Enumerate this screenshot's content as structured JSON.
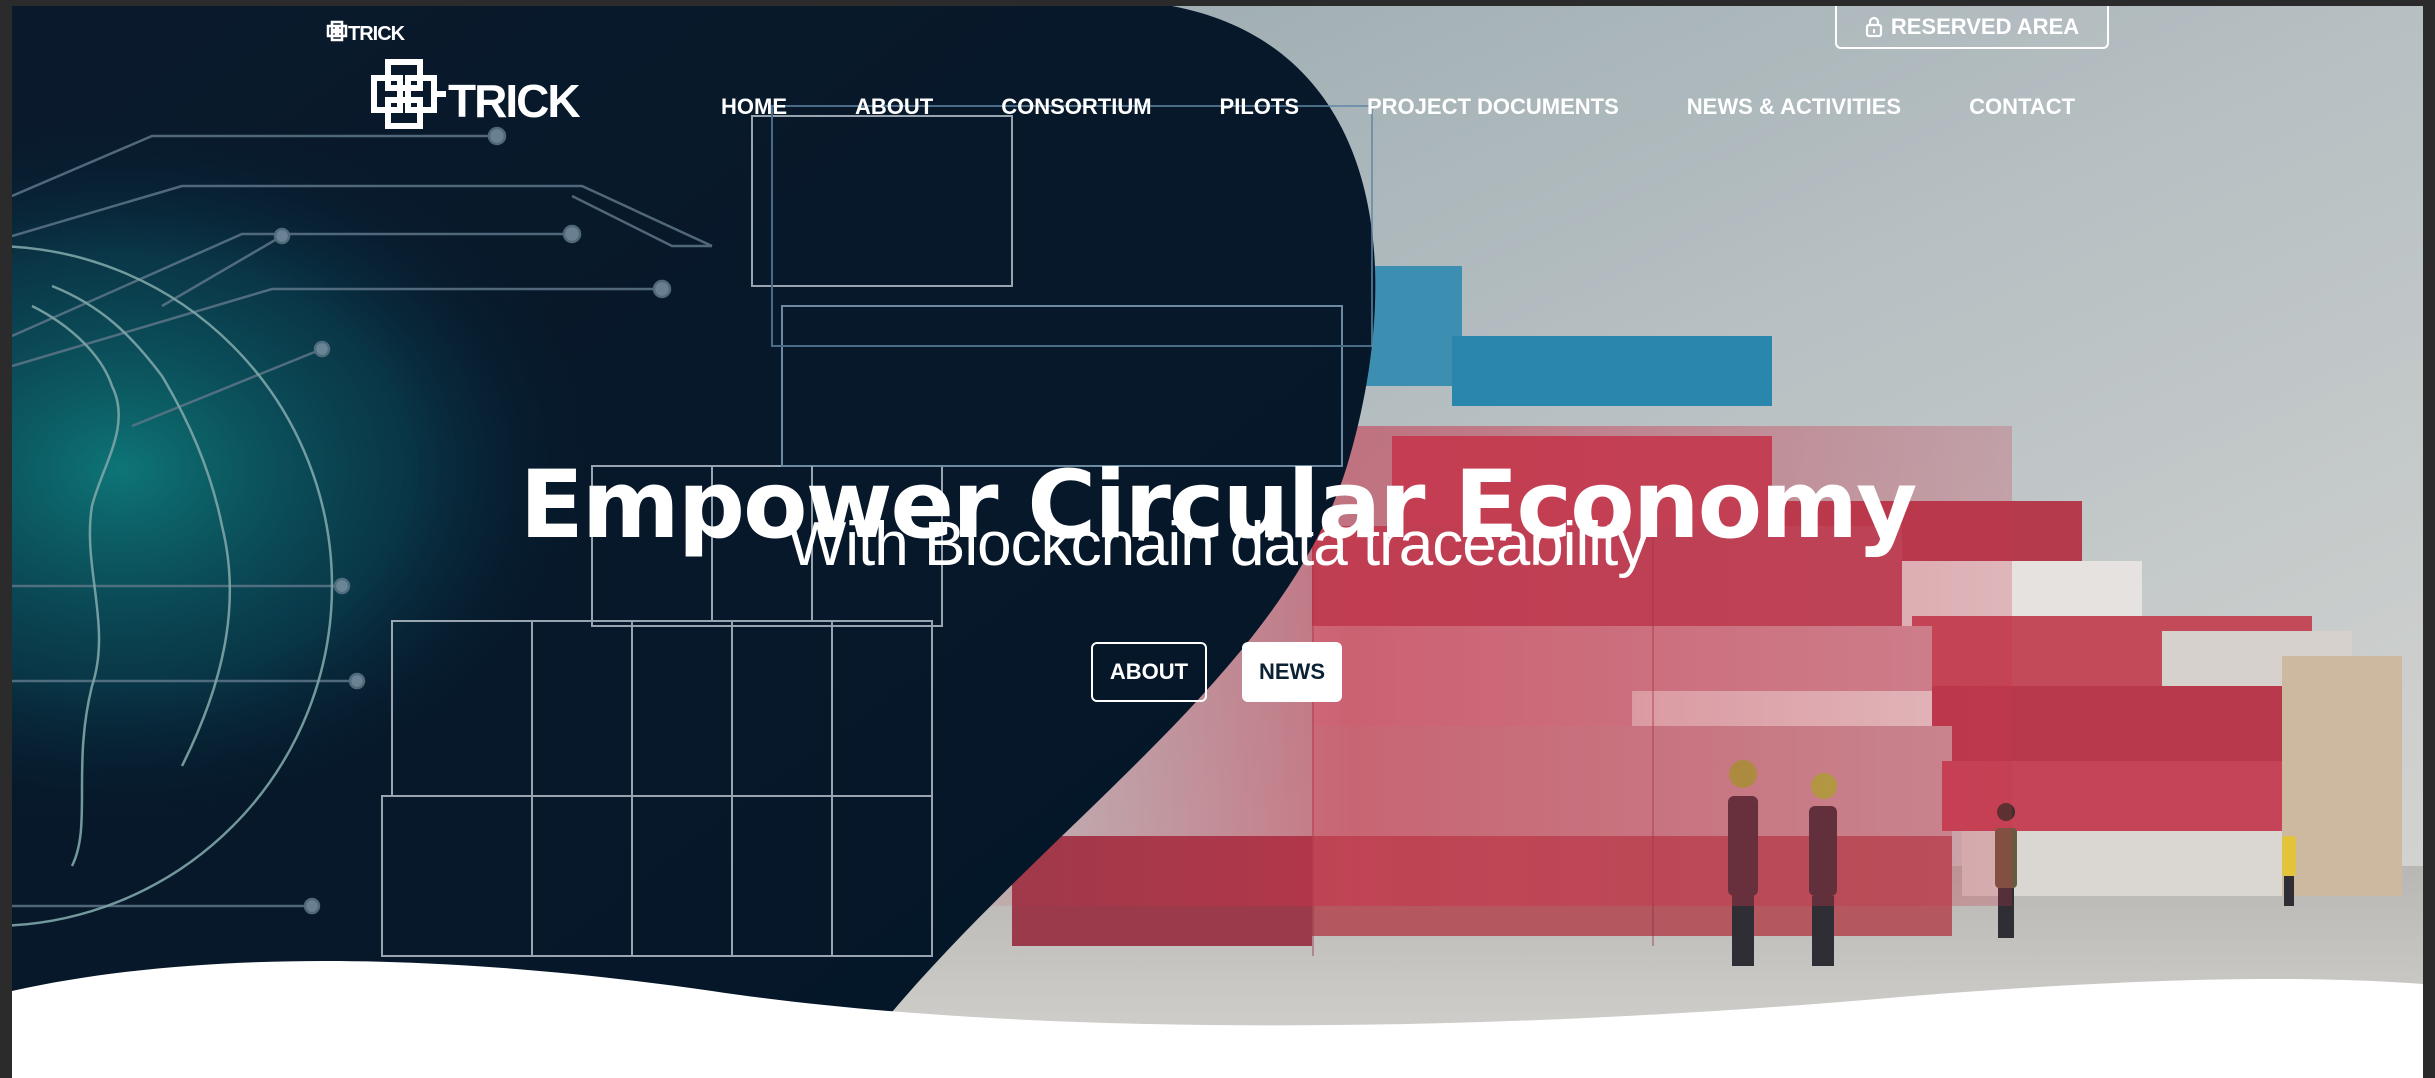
{
  "brand": {
    "logo_small": "TRICK",
    "logo_main": "TRICK"
  },
  "header": {
    "reserved_area": "RESERVED AREA",
    "nav": [
      {
        "label": "HOME"
      },
      {
        "label": "ABOUT"
      },
      {
        "label": "CONSORTIUM"
      },
      {
        "label": "PILOTS"
      },
      {
        "label": "PROJECT DOCUMENTS"
      },
      {
        "label": "NEWS & ACTIVITIES"
      },
      {
        "label": "CONTACT"
      }
    ]
  },
  "hero": {
    "title": "Empower Circular Economy",
    "subtitle": "With Blockchain data traceability",
    "buttons": {
      "about": "ABOUT",
      "news": "NEWS"
    }
  },
  "colors": {
    "navy": "#031a2e",
    "teal": "#0e6d73",
    "white": "#ffffff"
  },
  "icons": {
    "lock": "lock-icon",
    "logo": "trick-knot-logo-icon"
  }
}
